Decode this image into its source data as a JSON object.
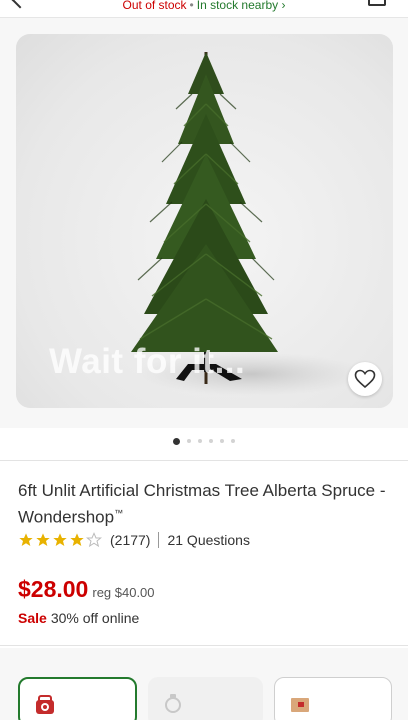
{
  "header": {
    "stock_status": "Out of stock",
    "separator": "•",
    "nearby_label": "In stock nearby ›"
  },
  "hero": {
    "overlay_text": "Wait for it...",
    "carousel": {
      "total": 6,
      "active_index": 0
    }
  },
  "product": {
    "title": "6ft Unlit Artificial Christmas Tree Alberta Spruce - Wondershop",
    "trademark": "™",
    "rating": {
      "stars": 4,
      "out_of": 5,
      "count_label": "(2177)"
    },
    "questions_label": "21 Questions",
    "price": "$28.00",
    "reg_price": "reg $40.00",
    "sale_label": "Sale",
    "sale_text": "30% off online"
  },
  "colors": {
    "brand_red": "#cc0000",
    "stock_green": "#237a2d",
    "star_gold": "#e8b200"
  },
  "icons": [
    "back-chevron-icon",
    "bag-icon",
    "heart-icon",
    "star-icon",
    "store-pickup-icon",
    "same-day-icon",
    "shipping-icon"
  ]
}
